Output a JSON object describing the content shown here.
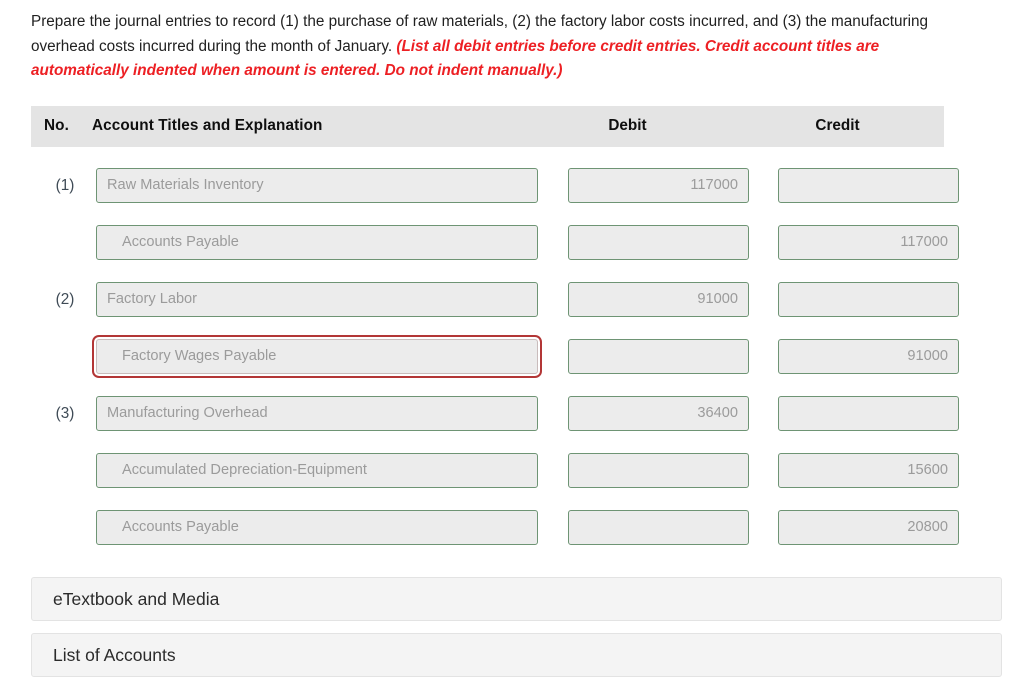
{
  "instructions": {
    "text_main_1": "Prepare the journal entries to record (1) the purchase of raw materials, (2) the factory labor costs incurred, and (3) the manufacturing overhead costs incurred during the month of January. ",
    "text_emphasis": "(List all debit entries before credit entries. Credit account titles are automatically indented when amount is entered. Do not indent manually.)"
  },
  "table": {
    "headers": {
      "no": "No.",
      "account": "Account Titles and Explanation",
      "debit": "Debit",
      "credit": "Credit"
    },
    "rows": [
      {
        "no": "(1)",
        "account": "Raw Materials Inventory",
        "indent": false,
        "invalid": false,
        "debit": "117000",
        "credit": ""
      },
      {
        "no": "",
        "account": "Accounts Payable",
        "indent": true,
        "invalid": false,
        "debit": "",
        "credit": "117000"
      },
      {
        "no": "(2)",
        "account": "Factory Labor",
        "indent": false,
        "invalid": false,
        "debit": "91000",
        "credit": ""
      },
      {
        "no": "",
        "account": "Factory Wages Payable",
        "indent": true,
        "invalid": true,
        "debit": "",
        "credit": "91000"
      },
      {
        "no": "(3)",
        "account": "Manufacturing Overhead",
        "indent": false,
        "invalid": false,
        "debit": "36400",
        "credit": ""
      },
      {
        "no": "",
        "account": "Accumulated Depreciation-Equipment",
        "indent": true,
        "invalid": false,
        "debit": "",
        "credit": "15600"
      },
      {
        "no": "",
        "account": "Accounts Payable",
        "indent": true,
        "invalid": false,
        "debit": "",
        "credit": "20800"
      }
    ]
  },
  "panels": {
    "etextbook": "eTextbook and Media",
    "accounts": "List of Accounts"
  },
  "colors": {
    "field_border_valid": "#6e9474",
    "field_border_invalid": "#b33636",
    "field_fill": "#ececec",
    "header_band": "#e4e4e4",
    "emphasis_red": "#ed2024",
    "panel_fill": "#f4f4f4"
  }
}
